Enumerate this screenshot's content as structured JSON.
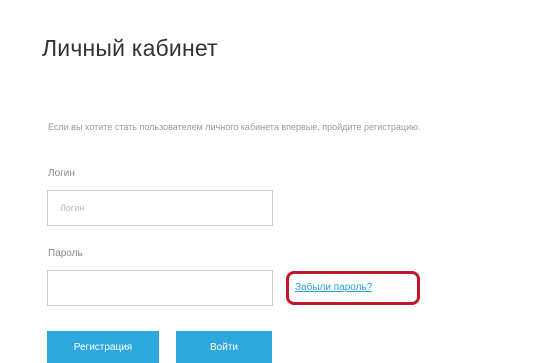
{
  "page": {
    "title": "Личный кабинет",
    "intro": "Если вы хотите стать пользователем личного кабинета впервые, пройдите регистрацию."
  },
  "form": {
    "login_label": "Логин",
    "login_placeholder": "Логин",
    "password_label": "Пароль",
    "password_value": "",
    "forgot_password_link": "Забыли пароль?"
  },
  "buttons": {
    "register_label": "Регистрация",
    "login_label": "Войти"
  },
  "colors": {
    "accent": "#2ea7dc",
    "highlight": "#c4162a",
    "link": "#2b9fd8"
  }
}
